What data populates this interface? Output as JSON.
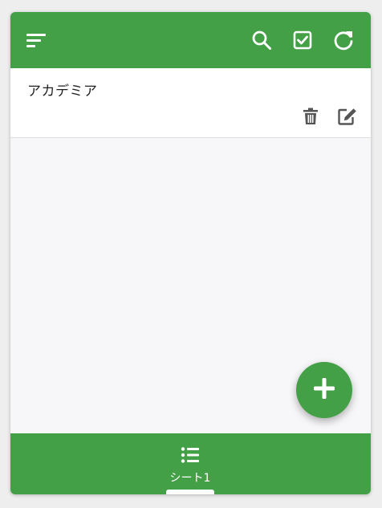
{
  "colors": {
    "primary": "#43a047",
    "surface": "#ffffff",
    "background": "#f7f7f9",
    "icon_dark": "#555555"
  },
  "toolbar": {
    "icons": [
      "sort-icon",
      "search-icon",
      "check-square-icon",
      "refresh-icon"
    ]
  },
  "list": {
    "items": [
      {
        "title": "アカデミア",
        "actions": [
          "delete-icon",
          "edit-icon"
        ]
      }
    ]
  },
  "fab": {
    "icon": "plus-icon"
  },
  "bottom_nav": {
    "tabs": [
      {
        "label": "シート1",
        "icon": "list-icon",
        "selected": true
      }
    ]
  }
}
